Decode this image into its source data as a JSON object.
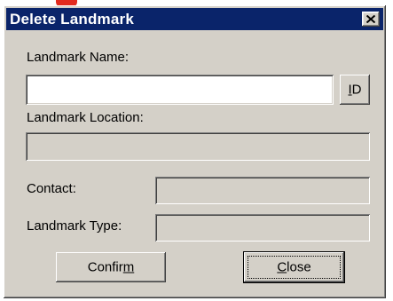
{
  "window": {
    "title": "Delete Landmark"
  },
  "fields": {
    "landmark_name": {
      "label": "Landmark Name:",
      "value": ""
    },
    "landmark_location": {
      "label": "Landmark Location:",
      "value": ""
    },
    "contact": {
      "label": "Contact:",
      "value": ""
    },
    "landmark_type": {
      "label": "Landmark Type:",
      "value": ""
    }
  },
  "buttons": {
    "id": {
      "label": "ID",
      "mnemonic": "I"
    },
    "confirm": {
      "label": "Confirm",
      "pre": "Confir",
      "mnemonic": "m",
      "post": ""
    },
    "close": {
      "label": "Close",
      "pre": "",
      "mnemonic": "C",
      "post": "lose"
    }
  },
  "icons": {
    "close": "close-icon"
  },
  "colors": {
    "titlebar": "#0a246a",
    "dialog": "#d4d0c8",
    "accent_corner": "#e32b1f"
  }
}
